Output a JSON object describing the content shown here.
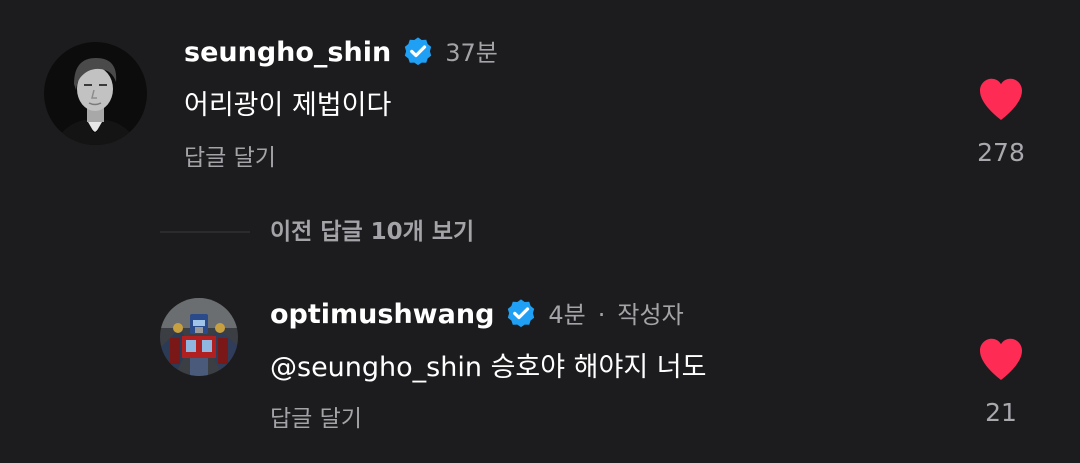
{
  "comments": [
    {
      "username": "seungho_shin",
      "time": "37분",
      "text": "어리광이 제법이다",
      "reply_label": "답글 달기",
      "likes": "278"
    }
  ],
  "view_previous_label": "이전 답글 10개 보기",
  "replies": [
    {
      "username": "optimushwang",
      "time": "4분",
      "separator": "·",
      "author_badge": "작성자",
      "mention": "@seungho_shin",
      "text": "승호야 해야지 너도",
      "reply_label": "답글 달기",
      "likes": "21"
    }
  ],
  "icons": {
    "like": "heart-icon",
    "verified": "verified-badge-icon"
  },
  "colors": {
    "background": "#1c1c1e",
    "heart": "#fe2c55",
    "verified": "#20a0f5",
    "secondary_text": "#a3a3a8"
  }
}
